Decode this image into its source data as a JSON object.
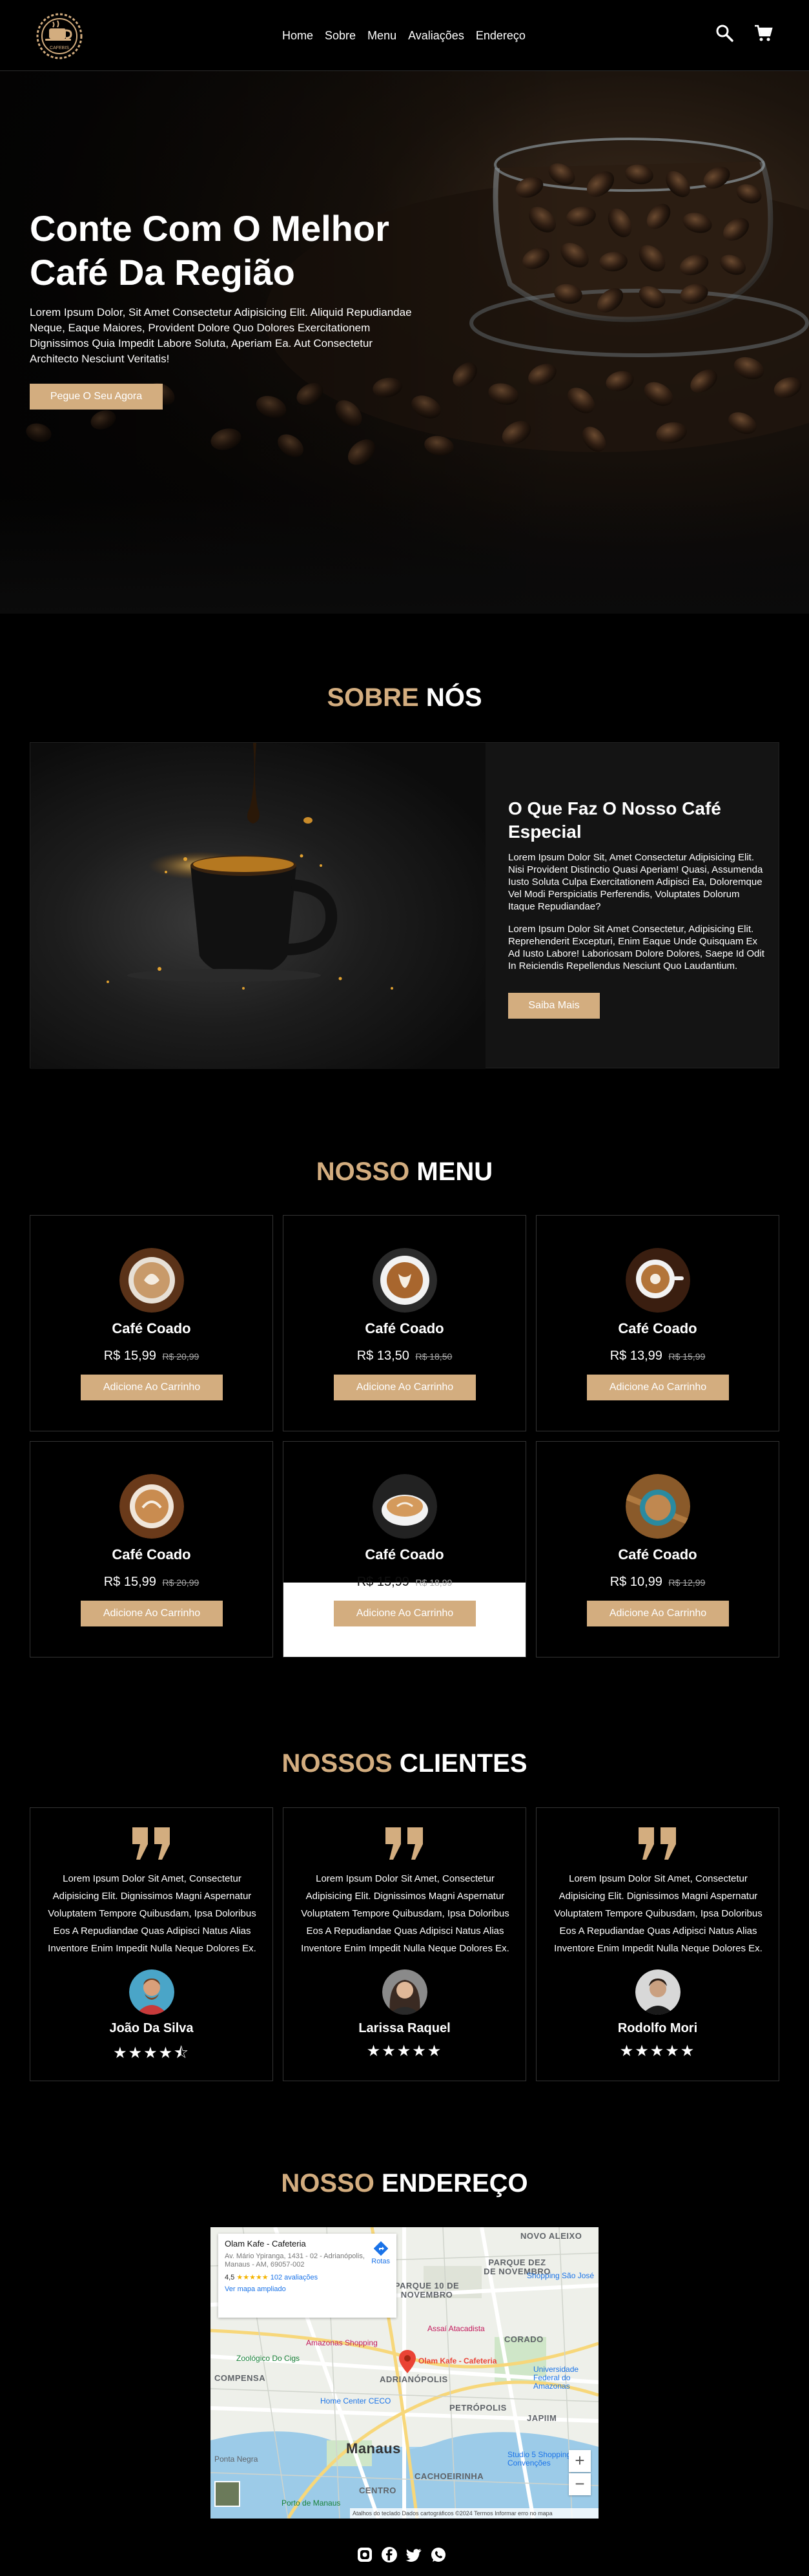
{
  "header": {
    "logo_text": "CAFEBIS",
    "nav": [
      "Home",
      "Sobre",
      "Menu",
      "Avaliações",
      "Endereço"
    ]
  },
  "hero": {
    "title_line1": "Conte Com O Melhor",
    "title_line2": "Café Da Região",
    "text": "Lorem Ipsum Dolor, Sit Amet Consectetur Adipisicing Elit. Aliquid Repudiandae Neque, Eaque Maiores, Provident Dolore Quo Dolores Exercitationem Dignissimos Quia Impedit Labore Soluta, Aperiam Ea. Aut Consectetur Architecto Nesciunt Veritatis!",
    "button": "Pegue O Seu Agora"
  },
  "about": {
    "title_accent": "Sobre",
    "title_rest": "Nós",
    "heading": "O Que Faz O Nosso Café Especial",
    "p1": "Lorem Ipsum Dolor Sit, Amet Consectetur Adipisicing Elit. Nisi Provident Distinctio Quasi Aperiam! Quasi, Assumenda Iusto Soluta Culpa Exercitationem Adipisci Ea, Doloremque Vel Modi Perspiciatis Perferendis, Voluptates Dolorum Itaque Repudiandae?",
    "p2": "Lorem Ipsum Dolor Sit Amet Consectetur, Adipisicing Elit. Reprehenderit Excepturi, Enim Eaque Unde Quisquam Ex Ad Iusto Labore! Laboriosam Dolore Dolores, Saepe Id Odit In Reiciendis Repellendus Nesciunt Quo Laudantium.",
    "button": "Saiba Mais"
  },
  "menu": {
    "title_accent": "Nosso",
    "title_rest": "Menu",
    "items": [
      {
        "name": "Café Coado",
        "price": "R$ 15,99",
        "old_price": "R$ 20,99",
        "button": "Adicione Ao Carrinho"
      },
      {
        "name": "Café Coado",
        "price": "R$ 13,50",
        "old_price": "R$ 18,50",
        "button": "Adicione Ao Carrinho"
      },
      {
        "name": "Café Coado",
        "price": "R$ 13,99",
        "old_price": "R$ 15,99",
        "button": "Adicione Ao Carrinho"
      },
      {
        "name": "Café Coado",
        "price": "R$ 15,99",
        "old_price": "R$ 20,99",
        "button": "Adicione Ao Carrinho"
      },
      {
        "name": "Café Coado",
        "price": "R$ 15,99",
        "old_price": "R$ 18,99",
        "button": "Adicione Ao Carrinho"
      },
      {
        "name": "Café Coado",
        "price": "R$ 10,99",
        "old_price": "R$ 12,99",
        "button": "Adicione Ao Carrinho"
      }
    ]
  },
  "reviews": {
    "title_accent": "Nossos",
    "title_rest": "Clientes",
    "items": [
      {
        "text": "Lorem Ipsum Dolor Sit Amet, Consectetur Adipisicing Elit. Dignissimos Magni Aspernatur Voluptatem Tempore Quibusdam, Ipsa Doloribus Eos A Repudiandae Quas Adipisci Natus Alias Inventore Enim Impedit Nulla Neque Dolores Ex.",
        "name": "João Da Silva",
        "stars": "★★★★⯪",
        "rating": 4.5
      },
      {
        "text": "Lorem Ipsum Dolor Sit Amet, Consectetur Adipisicing Elit. Dignissimos Magni Aspernatur Voluptatem Tempore Quibusdam, Ipsa Doloribus Eos A Repudiandae Quas Adipisci Natus Alias Inventore Enim Impedit Nulla Neque Dolores Ex.",
        "name": "Larissa Raquel",
        "stars": "★★★★★",
        "rating": 5
      },
      {
        "text": "Lorem Ipsum Dolor Sit Amet, Consectetur Adipisicing Elit. Dignissimos Magni Aspernatur Voluptatem Tempore Quibusdam, Ipsa Doloribus Eos A Repudiandae Quas Adipisci Natus Alias Inventore Enim Impedit Nulla Neque Dolores Ex.",
        "name": "Rodolfo Mori",
        "stars": "★★★★★",
        "rating": 5
      }
    ]
  },
  "address": {
    "title_accent": "Nosso",
    "title_rest": "Endereço",
    "map": {
      "place": "Olam Kafe - Cafeteria",
      "address": "Av. Mário Ypiranga, 1431 - 02 - Adrianópolis, Manaus - AM, 69057-002",
      "rating": "4,5",
      "stars": "★★★★★",
      "reviews": "102 avaliações",
      "larger": "Ver mapa ampliado",
      "route": "Rotas",
      "pin_label": "Olam Kafe - Cafeteria",
      "labels": [
        "NOVO ALEIXO",
        "PARQUE DEZ DE NOVEMBRO",
        "PARQUE 10 DE NOVEMBRO",
        "CORADO",
        "COMPENSA",
        "ADRIANÓPOLIS",
        "PETRÓPOLIS",
        "JAPIIM",
        "Manaus",
        "CENTRO",
        "CACHOEIRINHA"
      ],
      "places": [
        "Shopping São José",
        "Assaí Atacadista",
        "Amazonas Shopping",
        "Zoológico Do Cigs",
        "Home Center CECO",
        "Universidade Federal do Amazonas",
        "Studio 5 Shopping e Convenções",
        "Ponta Negra",
        "Porto de Manaus"
      ],
      "footer": "Atalhos do teclado   Dados cartográficos ©2024   Termos   Informar erro no mapa",
      "zoom_in": "+",
      "zoom_out": "−"
    }
  },
  "footer": {
    "social": [
      "instagram-icon",
      "facebook-icon",
      "twitter-icon",
      "whatsapp-icon"
    ]
  },
  "colors": {
    "accent": "#d3ad7f",
    "background": "#000000"
  }
}
